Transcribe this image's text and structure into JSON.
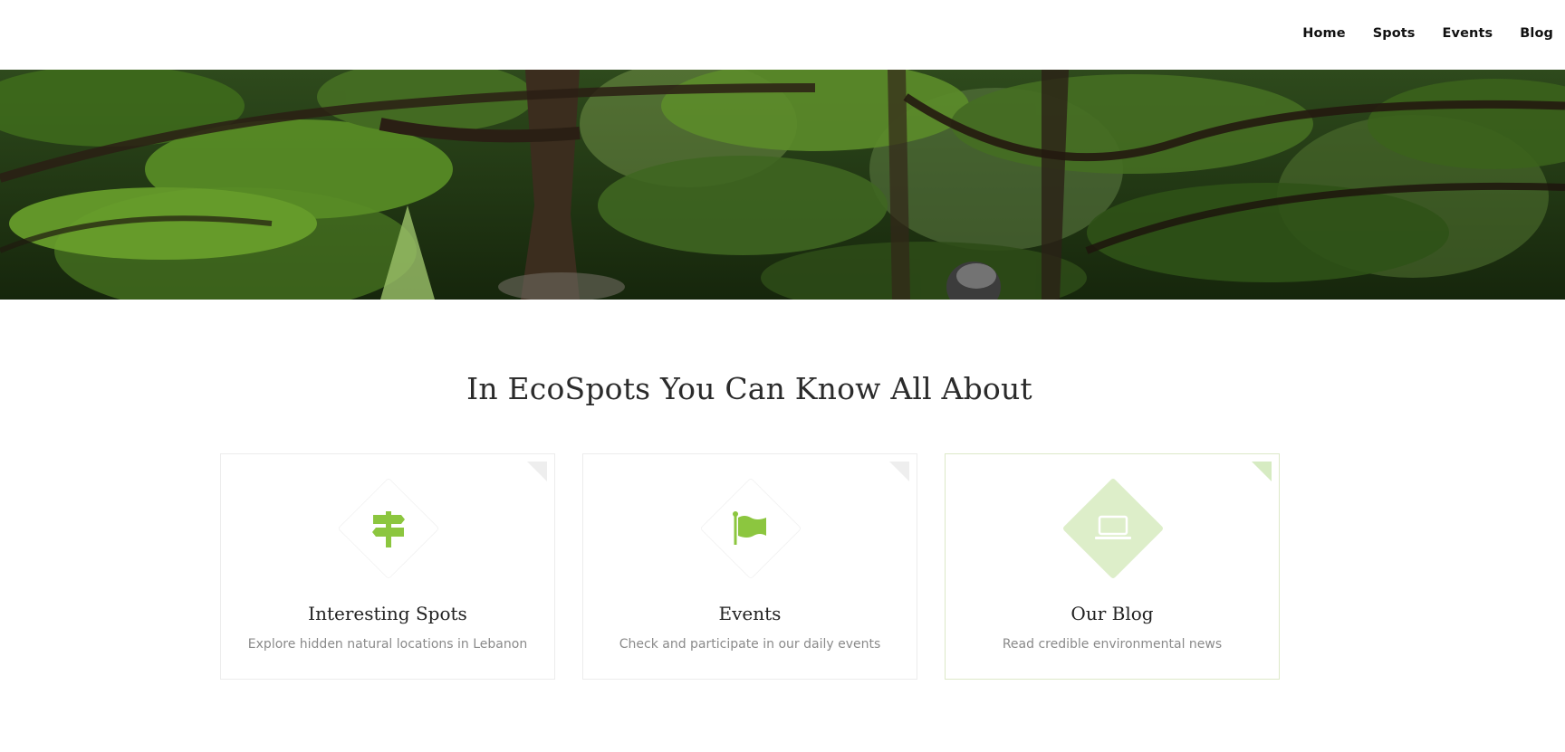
{
  "nav": {
    "items": [
      {
        "label": "Home"
      },
      {
        "label": "Spots"
      },
      {
        "label": "Events"
      },
      {
        "label": "Blog"
      }
    ]
  },
  "hero": {
    "image": "cedar-forest-photo"
  },
  "section": {
    "title": "In EcoSpots You Can Know All About"
  },
  "cards": [
    {
      "title": "Interesting Spots",
      "description": "Explore hidden natural locations in Lebanon",
      "icon": "signpost-icon",
      "state": "normal"
    },
    {
      "title": "Events",
      "description": "Check and participate in our daily events",
      "icon": "flag-icon",
      "state": "normal"
    },
    {
      "title": "Our Blog",
      "description": "Read credible environmental news",
      "icon": "laptop-icon",
      "state": "hovered"
    }
  ],
  "colors": {
    "accent": "#8cc63f",
    "accent_light": "#ddeec9",
    "text_dark": "#222222",
    "text_muted": "#8a8a8a"
  }
}
